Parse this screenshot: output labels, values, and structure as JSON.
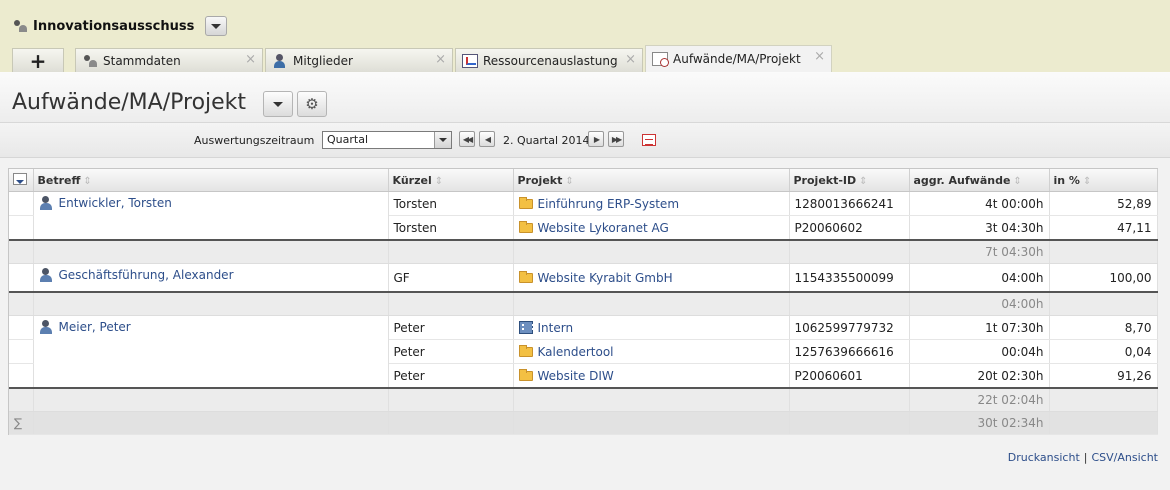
{
  "app": {
    "title": "Innovationsausschuss",
    "icon": "people-icon"
  },
  "tabs": [
    {
      "label": "+",
      "icon": "plus-icon"
    },
    {
      "label": "Stammdaten",
      "icon": "people-icon"
    },
    {
      "label": "Mitglieder",
      "icon": "person-icon"
    },
    {
      "label": "Ressourcenauslastung",
      "icon": "chart-icon"
    },
    {
      "label": "Aufwände/MA/Projekt",
      "icon": "clock-icon",
      "active": true
    }
  ],
  "tab_close": "×",
  "page": {
    "title": "Aufwände/MA/Projekt"
  },
  "filter": {
    "label": "Auswertungszeitraum",
    "period_type": "Quartal",
    "period_text": "2. Quartal 2014"
  },
  "table": {
    "headers": [
      "Betreff",
      "Kürzel",
      "Projekt",
      "Projekt-ID",
      "aggr. Aufwände",
      "in %"
    ],
    "sort_glyph": "⇕",
    "groups": [
      {
        "subject": "Entwickler, Torsten",
        "rows": [
          {
            "kuerzel": "Torsten",
            "projekt": "Einführung ERP-System",
            "projekt_icon": "folder-icon",
            "projekt_id": "1280013666241",
            "aufwand": "4t 00:00h",
            "prozent": "52,89"
          },
          {
            "kuerzel": "Torsten",
            "projekt": "Website Lykoranet AG",
            "projekt_icon": "folder-icon",
            "projekt_id": "P20060602",
            "aufwand": "3t 04:30h",
            "prozent": "47,11"
          }
        ],
        "sum": "7t 04:30h"
      },
      {
        "subject": "Geschäftsführung, Alexander",
        "rows": [
          {
            "kuerzel": "GF",
            "projekt": "Website Kyrabit GmbH",
            "projekt_icon": "folder-icon",
            "projekt_id": "1154335500099",
            "aufwand": "04:00h",
            "prozent": "100,00"
          }
        ],
        "sum": "04:00h"
      },
      {
        "subject": "Meier, Peter",
        "rows": [
          {
            "kuerzel": "Peter",
            "projekt": "Intern",
            "projekt_icon": "building-icon",
            "projekt_id": "1062599779732",
            "aufwand": "1t 07:30h",
            "prozent": "8,70"
          },
          {
            "kuerzel": "Peter",
            "projekt": "Kalendertool",
            "projekt_icon": "folder-icon",
            "projekt_id": "1257639666616",
            "aufwand": "00:04h",
            "prozent": "0,04"
          },
          {
            "kuerzel": "Peter",
            "projekt": "Website DIW",
            "projekt_icon": "folder-icon",
            "projekt_id": "P20060601",
            "aufwand": "20t 02:30h",
            "prozent": "91,26"
          }
        ],
        "sum": "22t 02:04h"
      }
    ],
    "total_symbol": "∑",
    "total": "30t 02:34h"
  },
  "footer": {
    "print_view": "Druckansicht",
    "csv_view": "CSV/Ansicht",
    "separator": "|"
  },
  "colors": {
    "topbar": "#ecebcf",
    "link": "#2d4e8a"
  }
}
